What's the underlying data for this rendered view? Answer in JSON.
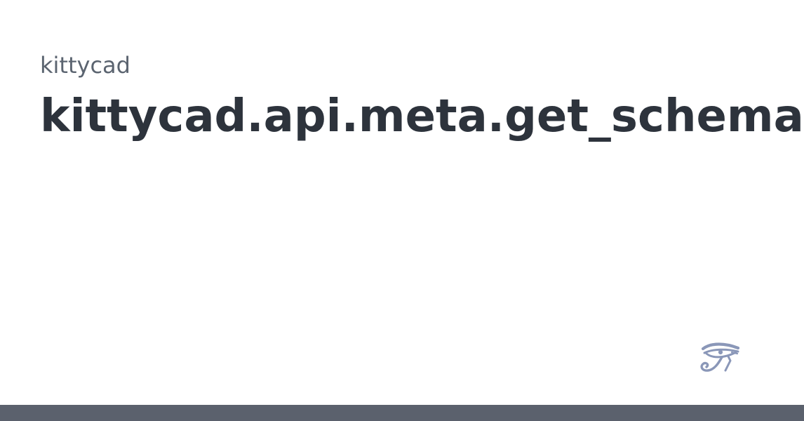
{
  "card": {
    "module_label": "kittycad",
    "symbol_title": "kittycad.api.meta.get_schema"
  },
  "logo": {
    "icon": "eye-of-horus-icon",
    "color": "#8a97b8"
  },
  "footer": {
    "color": "#5b616d"
  },
  "colors": {
    "background": "#ffffff",
    "module_text": "#5b6470",
    "title_text": "#2d333c"
  }
}
